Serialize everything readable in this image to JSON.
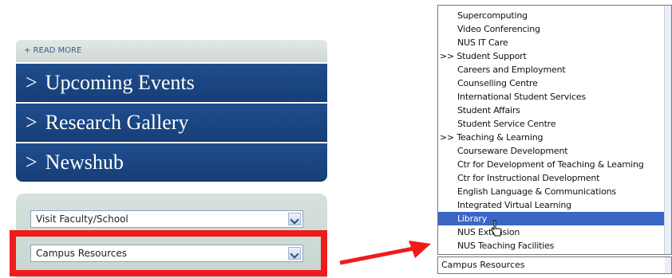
{
  "left_panel": {
    "read_more": "+ READ MORE",
    "nav": [
      {
        "chevron": ">",
        "label": "Upcoming Events"
      },
      {
        "chevron": ">",
        "label": "Research Gallery"
      },
      {
        "chevron": ">",
        "label": "Newshub"
      }
    ],
    "select_faculty": "Visit Faculty/School",
    "select_resources": "Campus Resources"
  },
  "dropdown": {
    "items": [
      {
        "label": "Supercomputing",
        "kind": "indent"
      },
      {
        "label": "Video Conferencing",
        "kind": "indent"
      },
      {
        "label": "NUS IT Care",
        "kind": "indent"
      },
      {
        "label": ">> Student Support",
        "kind": "group"
      },
      {
        "label": "Careers and Employment",
        "kind": "indent"
      },
      {
        "label": "Counselling Centre",
        "kind": "indent"
      },
      {
        "label": "International Student Services",
        "kind": "indent"
      },
      {
        "label": "Student Affairs",
        "kind": "indent"
      },
      {
        "label": "Student Service Centre",
        "kind": "indent"
      },
      {
        "label": ">> Teaching & Learning",
        "kind": "group"
      },
      {
        "label": "Courseware Development",
        "kind": "indent"
      },
      {
        "label": "Ctr for Development of Teaching & Learning",
        "kind": "indent"
      },
      {
        "label": "Ctr for Instructional Development",
        "kind": "indent"
      },
      {
        "label": "English Language & Communications",
        "kind": "indent"
      },
      {
        "label": "Integrated Virtual Learning",
        "kind": "indent"
      },
      {
        "label": "Library",
        "kind": "indent",
        "selected": true
      },
      {
        "label": "NUS Extension",
        "kind": "indent"
      },
      {
        "label": "NUS Teaching Facilities",
        "kind": "indent"
      }
    ],
    "current_value": "Campus Resources"
  },
  "colors": {
    "nav_blue": "#1f4d8d",
    "highlight_red": "#ee1c1c",
    "selected_blue": "#3b66c5"
  }
}
